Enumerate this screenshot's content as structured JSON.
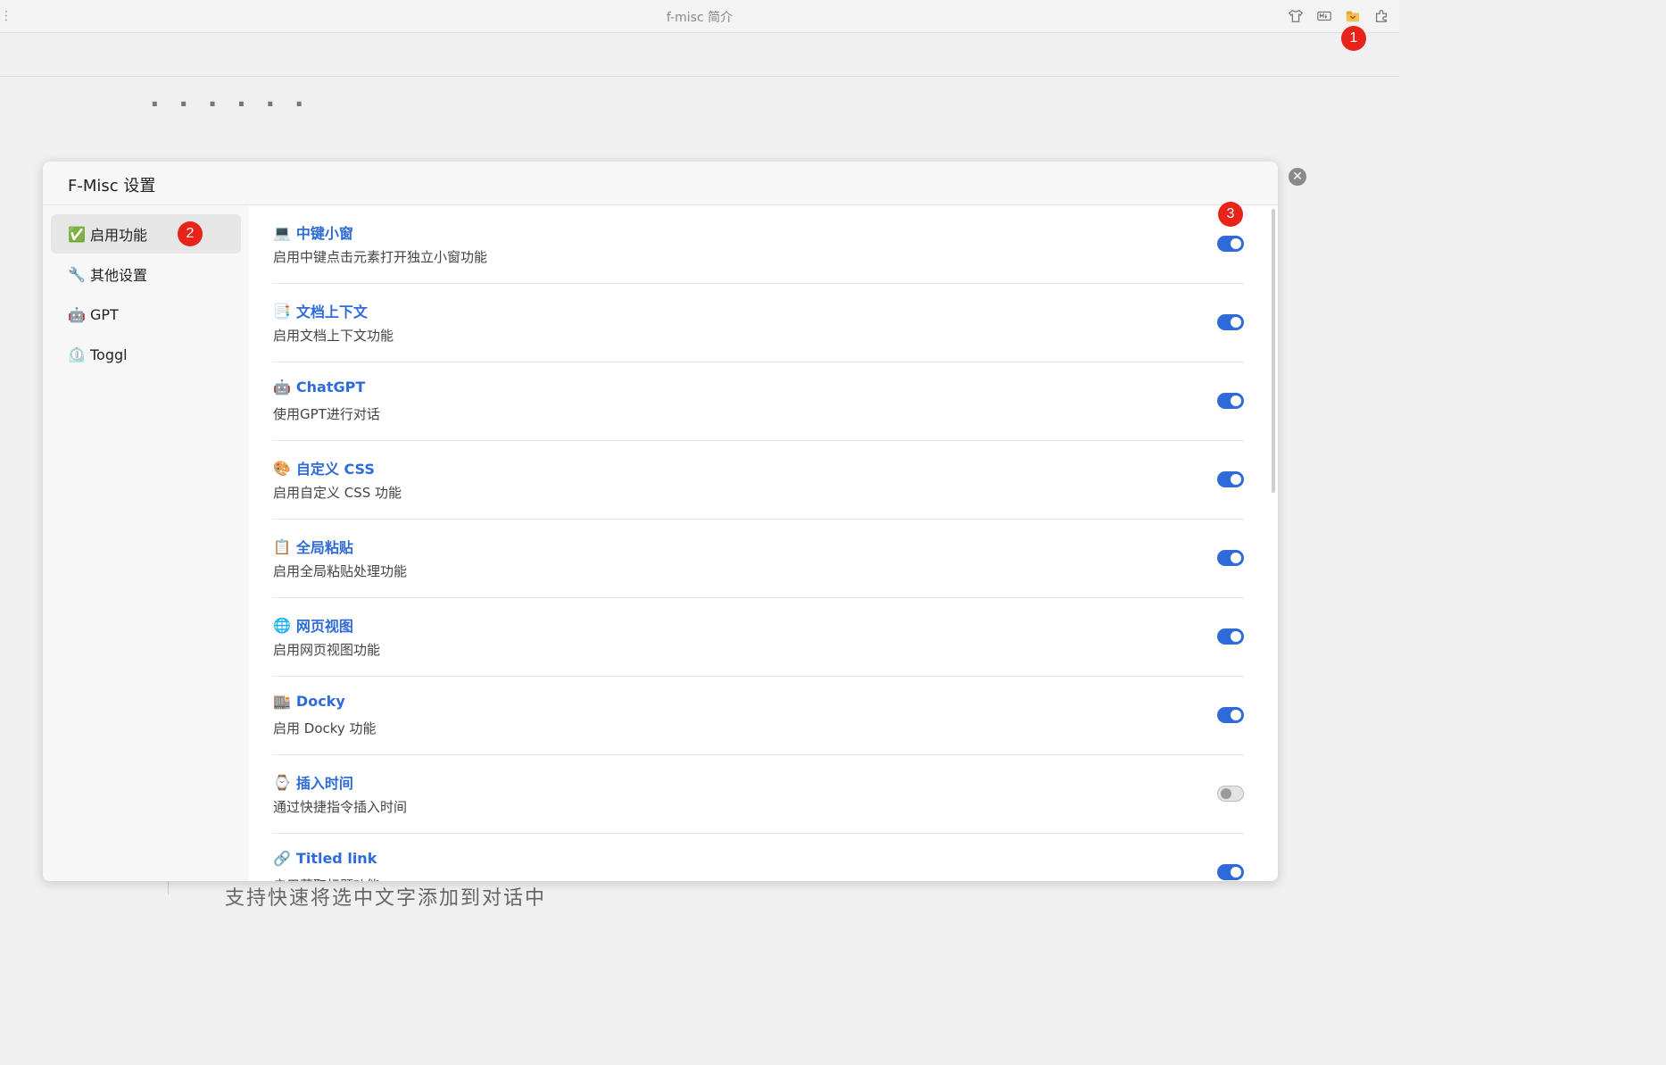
{
  "window": {
    "title": "f-misc 简介",
    "left_dots": "⋮"
  },
  "top_icons": [
    "tshirt-icon",
    "markdown-icon",
    "plugin-folder-icon",
    "extension-icon"
  ],
  "background": {
    "heading_fragment": "· · · · · ·",
    "bottom_text": "支持快速将选中文字添加到对话中",
    "colon": ":"
  },
  "markers": [
    "1",
    "2",
    "3"
  ],
  "dialog": {
    "title": "F-Misc 设置",
    "close_label": "✕"
  },
  "sidebar": {
    "items": [
      {
        "emoji": "✅",
        "label": "启用功能",
        "active": true
      },
      {
        "emoji": "🔧",
        "label": "其他设置",
        "active": false
      },
      {
        "emoji": "🤖",
        "label": "GPT",
        "active": false
      },
      {
        "emoji": "⏲️",
        "label": "Toggl",
        "active": false
      }
    ]
  },
  "features": [
    {
      "emoji": "💻",
      "title": "中键小窗",
      "desc": "启用中键点击元素打开独立小窗功能",
      "enabled": true
    },
    {
      "emoji": "📑",
      "title": "文档上下文",
      "desc": "启用文档上下文功能",
      "enabled": true
    },
    {
      "emoji": "🤖",
      "title": "ChatGPT",
      "desc": "使用GPT进行对话",
      "enabled": true
    },
    {
      "emoji": "🎨",
      "title": "自定义 CSS",
      "desc": "启用自定义 CSS 功能",
      "enabled": true
    },
    {
      "emoji": "📋",
      "title": "全局粘贴",
      "desc": "启用全局粘贴处理功能",
      "enabled": true
    },
    {
      "emoji": "🌐",
      "title": "网页视图",
      "desc": "启用网页视图功能",
      "enabled": true
    },
    {
      "emoji": "🏬",
      "title": "Docky",
      "desc": "启用 Docky 功能",
      "enabled": true
    },
    {
      "emoji": "⌚",
      "title": "插入时间",
      "desc": "通过快捷指令插入时间",
      "enabled": false
    },
    {
      "emoji": "🔗",
      "title": "Titled link",
      "desc": "启用获取标题功能",
      "enabled": true
    }
  ],
  "colors": {
    "accent": "#2e6bd9",
    "marker": "#e8231a",
    "toggle_off": "#e4e4e4"
  }
}
